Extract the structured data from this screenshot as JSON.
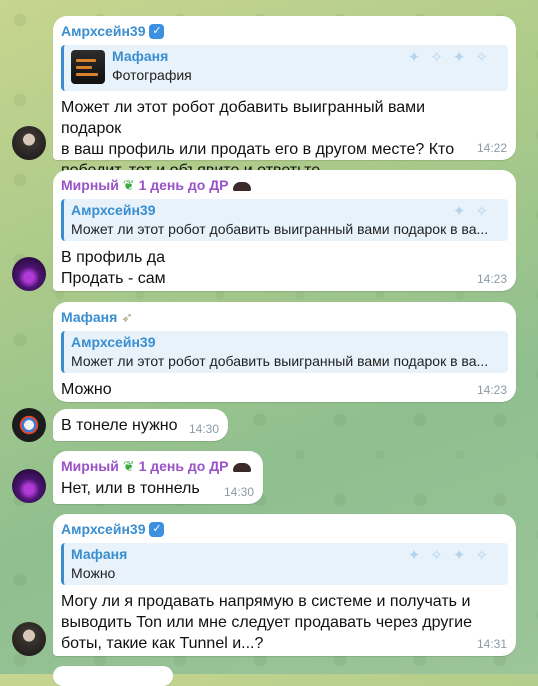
{
  "messages": [
    {
      "sender": "Амрхсейн39",
      "reply": {
        "name": "Мафаня",
        "text": "Фотография"
      },
      "lines": [
        "Может ли этот робот добавить выигранный вами подарок",
        "в ваш профиль или продать его в другом месте? Кто",
        "победит, тот и объявите и ответьте."
      ],
      "time": "14:22"
    },
    {
      "sender": "Мирный",
      "sender_extra": "1 день до ДР",
      "reply": {
        "name": "Амрхсейн39",
        "text": "Может ли этот робот добавить выигранный вами подарок в ва..."
      },
      "lines": [
        "В профиль да",
        "Продать - сам"
      ],
      "time": "14:23"
    },
    {
      "sender": "Мафаня",
      "reply": {
        "name": "Амрхсейн39",
        "text": "Может ли этот робот добавить выигранный вами подарок в ва..."
      },
      "lines": [
        "Можно"
      ],
      "time": "14:23"
    },
    {
      "lines": [
        "В тонеле нужно"
      ],
      "time": "14:30"
    },
    {
      "sender": "Мирный",
      "sender_extra": "1 день до ДР",
      "lines": [
        "Нет, или в тоннель"
      ],
      "time": "14:30"
    },
    {
      "sender": "Амрхсейн39",
      "reply": {
        "name": "Мафаня",
        "text": "Можно"
      },
      "lines": [
        "Могу ли я продавать напрямую в системе и получать и",
        "выводить Ton или мне следует продавать через другие",
        "боты, такие как Tunnel и...?"
      ],
      "time": "14:31"
    }
  ],
  "colors": {
    "name_blue": "#3a8ed0",
    "name_purple": "#9a52c9",
    "bubble": "#ffffff",
    "time": "#8d9aa6"
  }
}
